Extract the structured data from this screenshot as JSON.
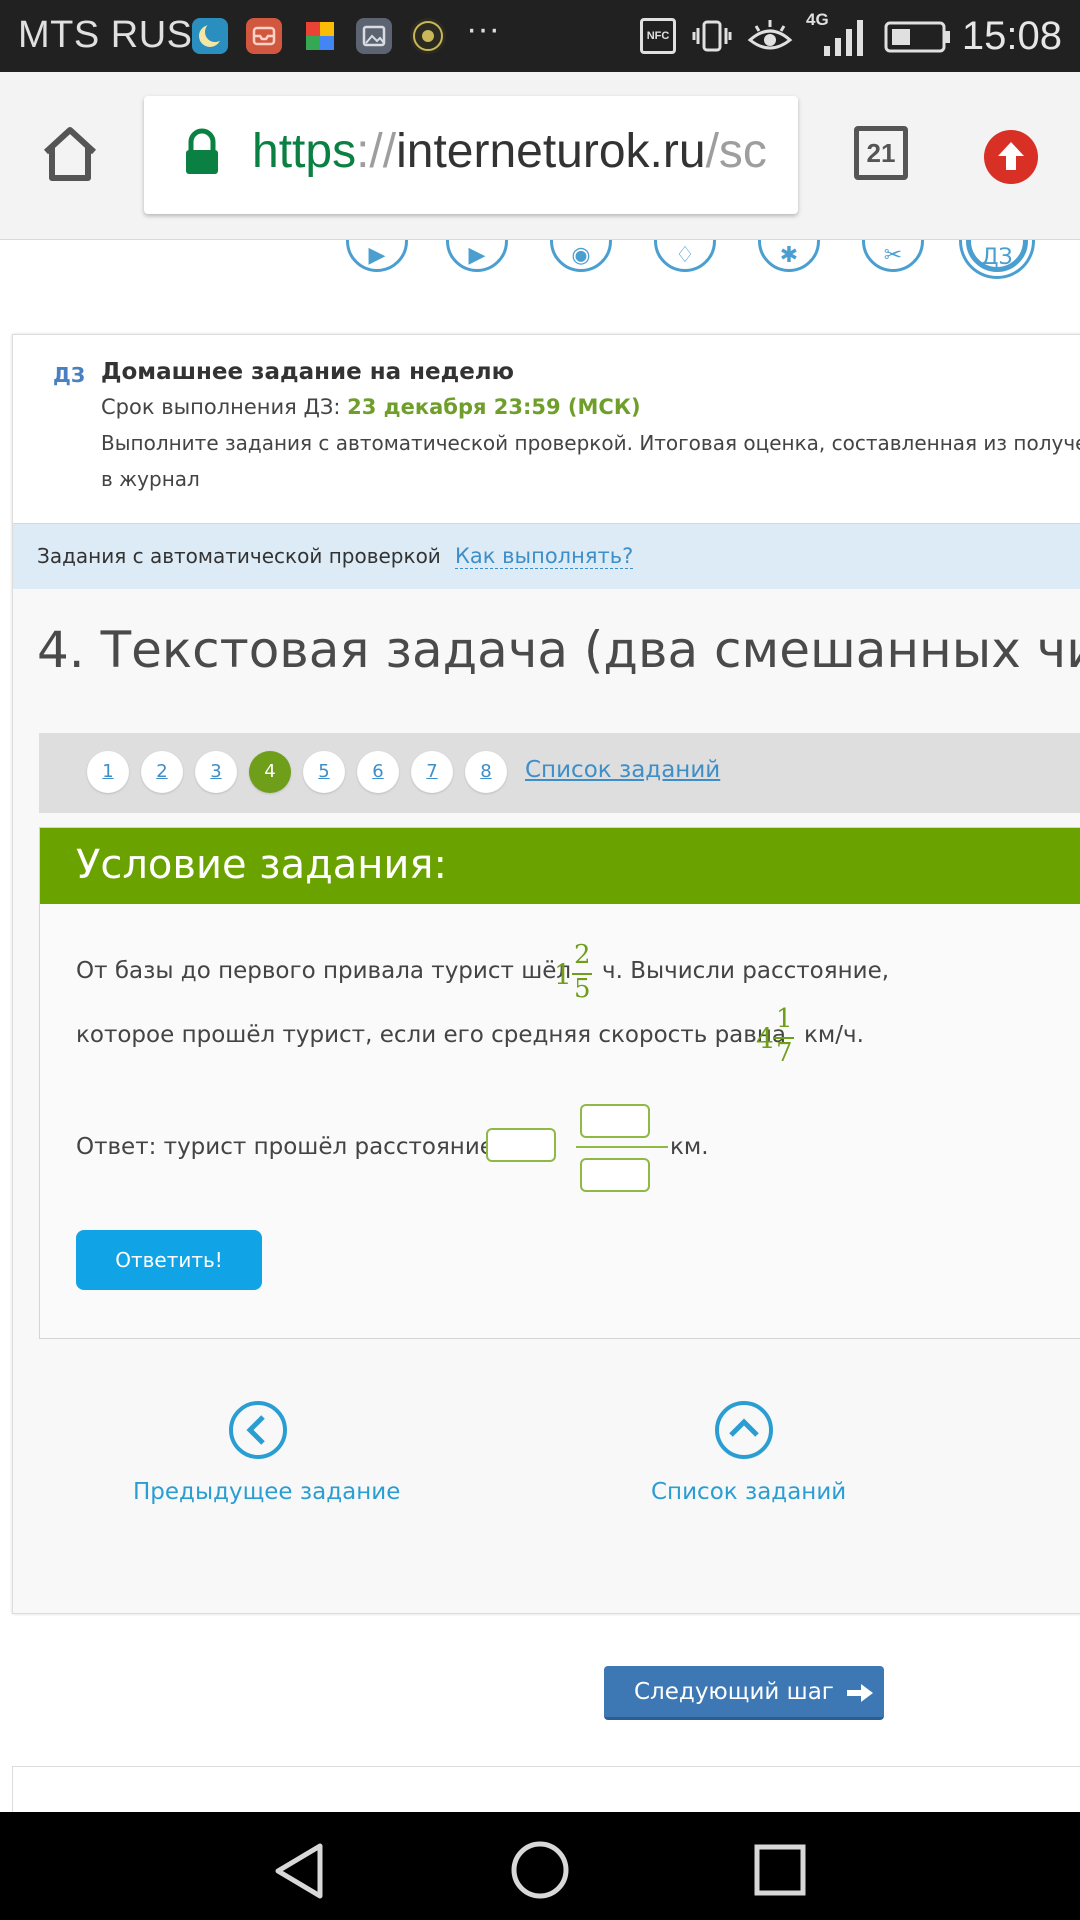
{
  "status_bar": {
    "carrier": "MTS RUS",
    "more": "···",
    "time": "15:08",
    "network": "4G",
    "nfc": "NFC"
  },
  "browser": {
    "url_scheme": "https",
    "url_sep": "://",
    "url_host": "interneturok.ru",
    "url_path": "/sc",
    "tab_count": "21"
  },
  "homework": {
    "tag": "ДЗ",
    "title": "Домашнее задание на неделю",
    "deadline_label": "Срок выполнения ДЗ: ",
    "deadline_value": "23 декабря 23:59 (МСК)",
    "desc_line1": "Выполните задания с автоматической проверкой. Итоговая оценка, составленная из получен",
    "desc_line2": "в журнал"
  },
  "auto_check": {
    "label": "Задания с автоматической проверкой",
    "how_link": "Как выполнять?"
  },
  "task": {
    "title": "4. Текстовая задача (два смешанных чи",
    "numbers": [
      "1",
      "2",
      "3",
      "4",
      "5",
      "6",
      "7",
      "8"
    ],
    "active": "4",
    "list_link": "Список заданий"
  },
  "condition": {
    "header": "Условие задания:",
    "line1_before": "От базы до первого привала турист шёл",
    "time_whole": "1",
    "time_num": "2",
    "time_den": "5",
    "line1_after": "ч. Вычисли расстояние,",
    "line2_before": "которое прошёл турист, если его средняя скорость равна",
    "speed_whole": "4",
    "speed_num": "1",
    "speed_den": "7",
    "line2_after": "км/ч.",
    "answer_label": "Ответ: турист прошёл расстояние",
    "answer_unit": "км.",
    "submit": "Ответить!"
  },
  "navigation": {
    "prev": "Предыдущее задание",
    "list": "Список заданий",
    "next_step": "Следующий шаг"
  },
  "colors": {
    "accent_green": "#6aa300",
    "link_blue": "#3e8ec8",
    "button_blue": "#10a4e6"
  }
}
